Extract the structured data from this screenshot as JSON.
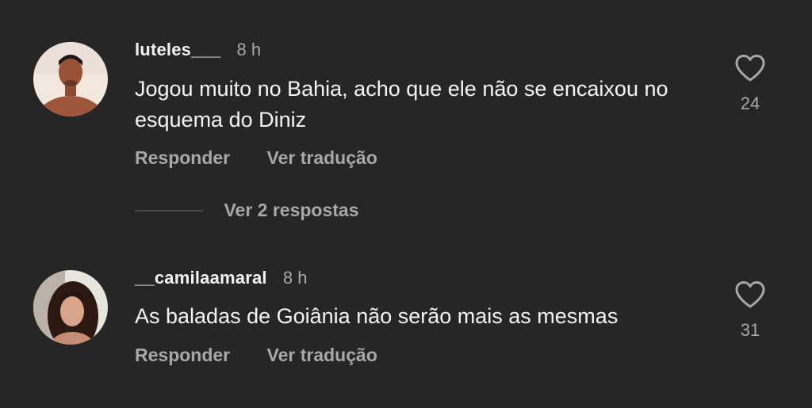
{
  "comments": [
    {
      "username": "luteles___",
      "time": "8 h",
      "text": "Jogou muito no Bahia, acho que ele não se encaixou no esquema do Diniz",
      "reply_label": "Responder",
      "translate_label": "Ver tradução",
      "like_count": "24",
      "like_icon": "heart-outline-icon"
    },
    {
      "username": "__camilaamaral",
      "time": "8 h",
      "text": "As baladas de Goiânia não serão mais as mesmas",
      "reply_label": "Responder",
      "translate_label": "Ver tradução",
      "like_count": "31",
      "like_icon": "heart-outline-icon"
    }
  ],
  "replies": {
    "label": "Ver 2 respostas"
  },
  "colors": {
    "background": "#262626",
    "primary_text": "#f5f5f5",
    "secondary_text": "#a8a8a8"
  }
}
